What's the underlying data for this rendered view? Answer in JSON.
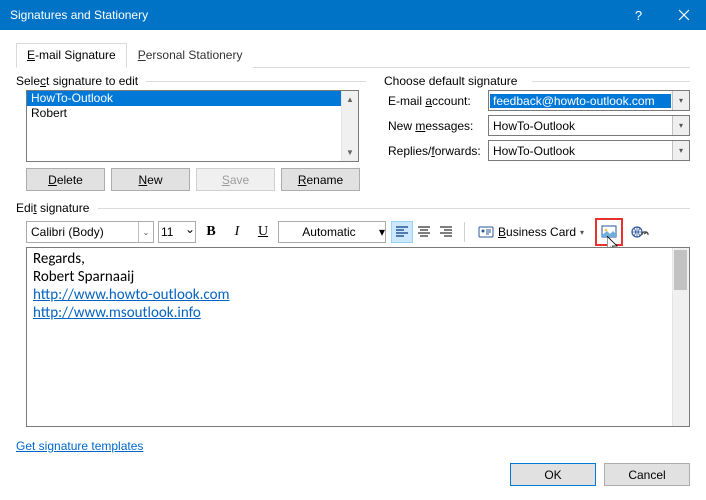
{
  "titlebar": {
    "title": "Signatures and Stationery"
  },
  "tabs": {
    "email_signature": "E-mail Signature",
    "personal_stationery": "Personal Stationery"
  },
  "select_signature": {
    "label": "Select signature to edit",
    "items": [
      "HowTo-Outlook",
      "Robert"
    ],
    "selected_index": 0
  },
  "signature_buttons": {
    "delete": "Delete",
    "new": "New",
    "save": "Save",
    "rename": "Rename"
  },
  "default_signature": {
    "label": "Choose default signature",
    "account_label": "E-mail account:",
    "account_value": "feedback@howto-outlook.com",
    "new_label": "New messages:",
    "new_value": "HowTo-Outlook",
    "reply_label": "Replies/forwards:",
    "reply_value": "HowTo-Outlook"
  },
  "edit": {
    "label": "Edit signature",
    "font": "Calibri (Body)",
    "size": "11",
    "color_label": "Automatic",
    "business_card": "Business Card",
    "content_line1": "Regards,",
    "content_line2": "Robert Sparnaaij",
    "content_link1": "http://www.howto-outlook.com",
    "content_link2": "http://www.msoutlook.info"
  },
  "link_templates": "Get signature templates",
  "footer": {
    "ok": "OK",
    "cancel": "Cancel"
  }
}
